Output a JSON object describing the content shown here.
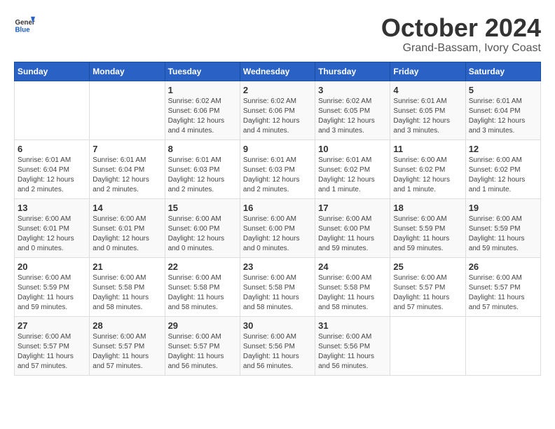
{
  "logo": {
    "text_general": "General",
    "text_blue": "Blue"
  },
  "header": {
    "title": "October 2024",
    "subtitle": "Grand-Bassam, Ivory Coast"
  },
  "days_of_week": [
    "Sunday",
    "Monday",
    "Tuesday",
    "Wednesday",
    "Thursday",
    "Friday",
    "Saturday"
  ],
  "weeks": [
    [
      {
        "num": "",
        "detail": ""
      },
      {
        "num": "",
        "detail": ""
      },
      {
        "num": "1",
        "detail": "Sunrise: 6:02 AM\nSunset: 6:06 PM\nDaylight: 12 hours and 4 minutes."
      },
      {
        "num": "2",
        "detail": "Sunrise: 6:02 AM\nSunset: 6:06 PM\nDaylight: 12 hours and 4 minutes."
      },
      {
        "num": "3",
        "detail": "Sunrise: 6:02 AM\nSunset: 6:05 PM\nDaylight: 12 hours and 3 minutes."
      },
      {
        "num": "4",
        "detail": "Sunrise: 6:01 AM\nSunset: 6:05 PM\nDaylight: 12 hours and 3 minutes."
      },
      {
        "num": "5",
        "detail": "Sunrise: 6:01 AM\nSunset: 6:04 PM\nDaylight: 12 hours and 3 minutes."
      }
    ],
    [
      {
        "num": "6",
        "detail": "Sunrise: 6:01 AM\nSunset: 6:04 PM\nDaylight: 12 hours and 2 minutes."
      },
      {
        "num": "7",
        "detail": "Sunrise: 6:01 AM\nSunset: 6:04 PM\nDaylight: 12 hours and 2 minutes."
      },
      {
        "num": "8",
        "detail": "Sunrise: 6:01 AM\nSunset: 6:03 PM\nDaylight: 12 hours and 2 minutes."
      },
      {
        "num": "9",
        "detail": "Sunrise: 6:01 AM\nSunset: 6:03 PM\nDaylight: 12 hours and 2 minutes."
      },
      {
        "num": "10",
        "detail": "Sunrise: 6:01 AM\nSunset: 6:02 PM\nDaylight: 12 hours and 1 minute."
      },
      {
        "num": "11",
        "detail": "Sunrise: 6:00 AM\nSunset: 6:02 PM\nDaylight: 12 hours and 1 minute."
      },
      {
        "num": "12",
        "detail": "Sunrise: 6:00 AM\nSunset: 6:02 PM\nDaylight: 12 hours and 1 minute."
      }
    ],
    [
      {
        "num": "13",
        "detail": "Sunrise: 6:00 AM\nSunset: 6:01 PM\nDaylight: 12 hours and 0 minutes."
      },
      {
        "num": "14",
        "detail": "Sunrise: 6:00 AM\nSunset: 6:01 PM\nDaylight: 12 hours and 0 minutes."
      },
      {
        "num": "15",
        "detail": "Sunrise: 6:00 AM\nSunset: 6:00 PM\nDaylight: 12 hours and 0 minutes."
      },
      {
        "num": "16",
        "detail": "Sunrise: 6:00 AM\nSunset: 6:00 PM\nDaylight: 12 hours and 0 minutes."
      },
      {
        "num": "17",
        "detail": "Sunrise: 6:00 AM\nSunset: 6:00 PM\nDaylight: 11 hours and 59 minutes."
      },
      {
        "num": "18",
        "detail": "Sunrise: 6:00 AM\nSunset: 5:59 PM\nDaylight: 11 hours and 59 minutes."
      },
      {
        "num": "19",
        "detail": "Sunrise: 6:00 AM\nSunset: 5:59 PM\nDaylight: 11 hours and 59 minutes."
      }
    ],
    [
      {
        "num": "20",
        "detail": "Sunrise: 6:00 AM\nSunset: 5:59 PM\nDaylight: 11 hours and 59 minutes."
      },
      {
        "num": "21",
        "detail": "Sunrise: 6:00 AM\nSunset: 5:58 PM\nDaylight: 11 hours and 58 minutes."
      },
      {
        "num": "22",
        "detail": "Sunrise: 6:00 AM\nSunset: 5:58 PM\nDaylight: 11 hours and 58 minutes."
      },
      {
        "num": "23",
        "detail": "Sunrise: 6:00 AM\nSunset: 5:58 PM\nDaylight: 11 hours and 58 minutes."
      },
      {
        "num": "24",
        "detail": "Sunrise: 6:00 AM\nSunset: 5:58 PM\nDaylight: 11 hours and 58 minutes."
      },
      {
        "num": "25",
        "detail": "Sunrise: 6:00 AM\nSunset: 5:57 PM\nDaylight: 11 hours and 57 minutes."
      },
      {
        "num": "26",
        "detail": "Sunrise: 6:00 AM\nSunset: 5:57 PM\nDaylight: 11 hours and 57 minutes."
      }
    ],
    [
      {
        "num": "27",
        "detail": "Sunrise: 6:00 AM\nSunset: 5:57 PM\nDaylight: 11 hours and 57 minutes."
      },
      {
        "num": "28",
        "detail": "Sunrise: 6:00 AM\nSunset: 5:57 PM\nDaylight: 11 hours and 57 minutes."
      },
      {
        "num": "29",
        "detail": "Sunrise: 6:00 AM\nSunset: 5:57 PM\nDaylight: 11 hours and 56 minutes."
      },
      {
        "num": "30",
        "detail": "Sunrise: 6:00 AM\nSunset: 5:56 PM\nDaylight: 11 hours and 56 minutes."
      },
      {
        "num": "31",
        "detail": "Sunrise: 6:00 AM\nSunset: 5:56 PM\nDaylight: 11 hours and 56 minutes."
      },
      {
        "num": "",
        "detail": ""
      },
      {
        "num": "",
        "detail": ""
      }
    ]
  ]
}
